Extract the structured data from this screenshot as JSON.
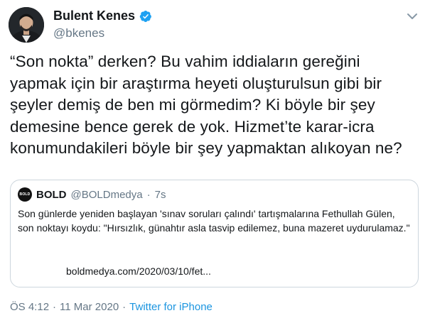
{
  "author": {
    "display_name": "Bulent Kenes",
    "handle": "@bkenes",
    "verified": true
  },
  "tweet": {
    "text": "“Son nokta” derken? Bu vahim iddiaların gereğini\nyapmak için bir araştırma heyeti oluşturulsun gibi bir\nşeyler demiş de ben mi görmedim? Ki böyle bir şey\ndemesine bence gerek de yok. Hizmet’te karar-icra\nkonumundakileri böyle bir şey yapmaktan alıkoyan ne?"
  },
  "quoted_tweet": {
    "avatar_text": "BOLD",
    "display_name": "BOLD",
    "handle": "@BOLDmedya",
    "separator": "·",
    "time": "7s",
    "text": "Son günlerde yeniden başlayan 'sınav soruları çalındı' tartışmalarına Fethullah Gülen, son noktayı koydu: \"Hırsızlık, günahtır asla tasvip edilemez, buna mazeret uydurulamaz.\"",
    "link": "boldmedya.com/2020/03/10/fet..."
  },
  "meta": {
    "time": "ÖS 4:12",
    "separator1": "·",
    "date": "11 Mar 2020",
    "separator2": "·",
    "source": "Twitter for iPhone"
  },
  "colors": {
    "verified_badge": "#1da1f2",
    "secondary_text": "#657786",
    "link": "#1b95e0"
  },
  "icons": {
    "more": "chevron-down-icon",
    "verified": "verified-badge-icon"
  }
}
